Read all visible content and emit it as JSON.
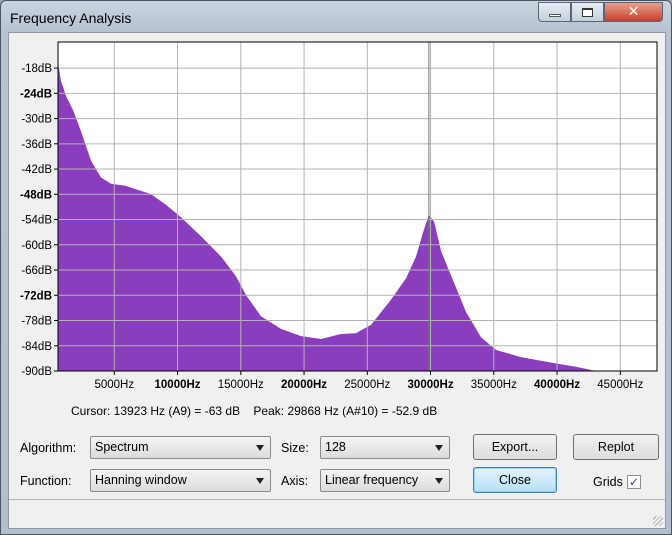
{
  "window": {
    "title": "Frequency Analysis",
    "minimize_icon": "minimize-icon",
    "maximize_icon": "restore-icon",
    "close_icon": "close-icon"
  },
  "chart_data": {
    "type": "area",
    "title": "",
    "xlabel": "",
    "ylabel": "",
    "xlim": [
      550,
      47900
    ],
    "ylim": [
      -90,
      -11.8
    ],
    "grid": true,
    "fill_color": "#8a3dbd",
    "x_ticks": [
      {
        "value": 5000,
        "label": "5000Hz",
        "bold": false
      },
      {
        "value": 10000,
        "label": "10000Hz",
        "bold": true
      },
      {
        "value": 15000,
        "label": "15000Hz",
        "bold": false
      },
      {
        "value": 20000,
        "label": "20000Hz",
        "bold": true
      },
      {
        "value": 25000,
        "label": "25000Hz",
        "bold": false
      },
      {
        "value": 30000,
        "label": "30000Hz",
        "bold": true
      },
      {
        "value": 35000,
        "label": "35000Hz",
        "bold": false
      },
      {
        "value": 40000,
        "label": "40000Hz",
        "bold": true
      },
      {
        "value": 45000,
        "label": "45000Hz",
        "bold": false
      }
    ],
    "y_ticks": [
      {
        "value": -18,
        "label": "-18dB",
        "bold": false
      },
      {
        "value": -24,
        "label": "-24dB",
        "bold": true
      },
      {
        "value": -30,
        "label": "-30dB",
        "bold": false
      },
      {
        "value": -36,
        "label": "-36dB",
        "bold": false
      },
      {
        "value": -42,
        "label": "-42dB",
        "bold": false
      },
      {
        "value": -48,
        "label": "-48dB",
        "bold": true
      },
      {
        "value": -54,
        "label": "-54dB",
        "bold": false
      },
      {
        "value": -60,
        "label": "-60dB",
        "bold": false
      },
      {
        "value": -66,
        "label": "-66dB",
        "bold": false
      },
      {
        "value": -72,
        "label": "-72dB",
        "bold": true
      },
      {
        "value": -78,
        "label": "-78dB",
        "bold": false
      },
      {
        "value": -84,
        "label": "-84dB",
        "bold": false
      },
      {
        "value": -90,
        "label": "-90dB",
        "bold": false
      }
    ],
    "x": [
      550,
      790,
      1190,
      1740,
      2370,
      3160,
      3950,
      4740,
      5930,
      7900,
      9090,
      10280,
      11860,
      13440,
      14620,
      15420,
      16600,
      18180,
      19760,
      21340,
      22920,
      24110,
      25300,
      26880,
      28060,
      28850,
      29410,
      29868,
      30280,
      30830,
      31780,
      32810,
      33990,
      35180,
      37150,
      39530,
      41500,
      43080
    ],
    "y": [
      -16.8,
      -21,
      -24.7,
      -28,
      -33,
      -40,
      -44,
      -45.5,
      -46,
      -48,
      -50.5,
      -53.5,
      -58,
      -62.8,
      -67.5,
      -72,
      -77,
      -80,
      -81.7,
      -82.4,
      -81.2,
      -81,
      -79,
      -73,
      -68,
      -62.8,
      -57,
      -52.9,
      -54.5,
      -61.5,
      -68.5,
      -76,
      -82,
      -85,
      -86.7,
      -88,
      -89,
      -90
    ]
  },
  "readout": {
    "cursor": "Cursor: 13923 Hz (A9) = -63 dB",
    "peak": "Peak: 29868 Hz (A#10) = -52.9 dB"
  },
  "controls": {
    "algorithm_label": "Algorithm:",
    "algorithm_value": "Spectrum",
    "size_label": "Size:",
    "size_value": "128",
    "function_label": "Function:",
    "function_value": "Hanning window",
    "axis_label": "Axis:",
    "axis_value": "Linear frequency",
    "export": "Export...",
    "replot": "Replot",
    "close": "Close",
    "grids_label": "Grids",
    "grids_checked": true
  }
}
